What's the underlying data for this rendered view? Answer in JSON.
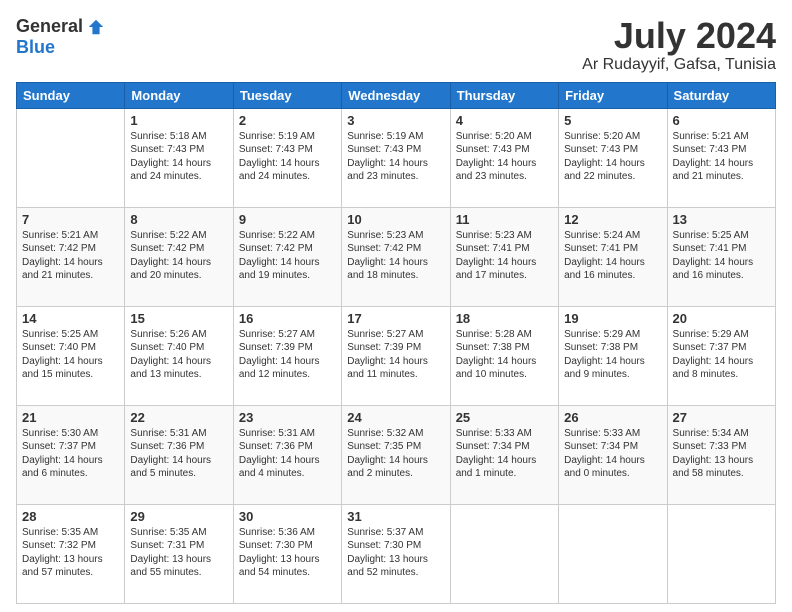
{
  "logo": {
    "general": "General",
    "blue": "Blue"
  },
  "title": "July 2024",
  "location": "Ar Rudayyif, Gafsa, Tunisia",
  "headers": [
    "Sunday",
    "Monday",
    "Tuesday",
    "Wednesday",
    "Thursday",
    "Friday",
    "Saturday"
  ],
  "weeks": [
    [
      {
        "day": "",
        "info": ""
      },
      {
        "day": "1",
        "info": "Sunrise: 5:18 AM\nSunset: 7:43 PM\nDaylight: 14 hours\nand 24 minutes."
      },
      {
        "day": "2",
        "info": "Sunrise: 5:19 AM\nSunset: 7:43 PM\nDaylight: 14 hours\nand 24 minutes."
      },
      {
        "day": "3",
        "info": "Sunrise: 5:19 AM\nSunset: 7:43 PM\nDaylight: 14 hours\nand 23 minutes."
      },
      {
        "day": "4",
        "info": "Sunrise: 5:20 AM\nSunset: 7:43 PM\nDaylight: 14 hours\nand 23 minutes."
      },
      {
        "day": "5",
        "info": "Sunrise: 5:20 AM\nSunset: 7:43 PM\nDaylight: 14 hours\nand 22 minutes."
      },
      {
        "day": "6",
        "info": "Sunrise: 5:21 AM\nSunset: 7:43 PM\nDaylight: 14 hours\nand 21 minutes."
      }
    ],
    [
      {
        "day": "7",
        "info": "Sunrise: 5:21 AM\nSunset: 7:42 PM\nDaylight: 14 hours\nand 21 minutes."
      },
      {
        "day": "8",
        "info": "Sunrise: 5:22 AM\nSunset: 7:42 PM\nDaylight: 14 hours\nand 20 minutes."
      },
      {
        "day": "9",
        "info": "Sunrise: 5:22 AM\nSunset: 7:42 PM\nDaylight: 14 hours\nand 19 minutes."
      },
      {
        "day": "10",
        "info": "Sunrise: 5:23 AM\nSunset: 7:42 PM\nDaylight: 14 hours\nand 18 minutes."
      },
      {
        "day": "11",
        "info": "Sunrise: 5:23 AM\nSunset: 7:41 PM\nDaylight: 14 hours\nand 17 minutes."
      },
      {
        "day": "12",
        "info": "Sunrise: 5:24 AM\nSunset: 7:41 PM\nDaylight: 14 hours\nand 16 minutes."
      },
      {
        "day": "13",
        "info": "Sunrise: 5:25 AM\nSunset: 7:41 PM\nDaylight: 14 hours\nand 16 minutes."
      }
    ],
    [
      {
        "day": "14",
        "info": "Sunrise: 5:25 AM\nSunset: 7:40 PM\nDaylight: 14 hours\nand 15 minutes."
      },
      {
        "day": "15",
        "info": "Sunrise: 5:26 AM\nSunset: 7:40 PM\nDaylight: 14 hours\nand 13 minutes."
      },
      {
        "day": "16",
        "info": "Sunrise: 5:27 AM\nSunset: 7:39 PM\nDaylight: 14 hours\nand 12 minutes."
      },
      {
        "day": "17",
        "info": "Sunrise: 5:27 AM\nSunset: 7:39 PM\nDaylight: 14 hours\nand 11 minutes."
      },
      {
        "day": "18",
        "info": "Sunrise: 5:28 AM\nSunset: 7:38 PM\nDaylight: 14 hours\nand 10 minutes."
      },
      {
        "day": "19",
        "info": "Sunrise: 5:29 AM\nSunset: 7:38 PM\nDaylight: 14 hours\nand 9 minutes."
      },
      {
        "day": "20",
        "info": "Sunrise: 5:29 AM\nSunset: 7:37 PM\nDaylight: 14 hours\nand 8 minutes."
      }
    ],
    [
      {
        "day": "21",
        "info": "Sunrise: 5:30 AM\nSunset: 7:37 PM\nDaylight: 14 hours\nand 6 minutes."
      },
      {
        "day": "22",
        "info": "Sunrise: 5:31 AM\nSunset: 7:36 PM\nDaylight: 14 hours\nand 5 minutes."
      },
      {
        "day": "23",
        "info": "Sunrise: 5:31 AM\nSunset: 7:36 PM\nDaylight: 14 hours\nand 4 minutes."
      },
      {
        "day": "24",
        "info": "Sunrise: 5:32 AM\nSunset: 7:35 PM\nDaylight: 14 hours\nand 2 minutes."
      },
      {
        "day": "25",
        "info": "Sunrise: 5:33 AM\nSunset: 7:34 PM\nDaylight: 14 hours\nand 1 minute."
      },
      {
        "day": "26",
        "info": "Sunrise: 5:33 AM\nSunset: 7:34 PM\nDaylight: 14 hours\nand 0 minutes."
      },
      {
        "day": "27",
        "info": "Sunrise: 5:34 AM\nSunset: 7:33 PM\nDaylight: 13 hours\nand 58 minutes."
      }
    ],
    [
      {
        "day": "28",
        "info": "Sunrise: 5:35 AM\nSunset: 7:32 PM\nDaylight: 13 hours\nand 57 minutes."
      },
      {
        "day": "29",
        "info": "Sunrise: 5:35 AM\nSunset: 7:31 PM\nDaylight: 13 hours\nand 55 minutes."
      },
      {
        "day": "30",
        "info": "Sunrise: 5:36 AM\nSunset: 7:30 PM\nDaylight: 13 hours\nand 54 minutes."
      },
      {
        "day": "31",
        "info": "Sunrise: 5:37 AM\nSunset: 7:30 PM\nDaylight: 13 hours\nand 52 minutes."
      },
      {
        "day": "",
        "info": ""
      },
      {
        "day": "",
        "info": ""
      },
      {
        "day": "",
        "info": ""
      }
    ]
  ]
}
